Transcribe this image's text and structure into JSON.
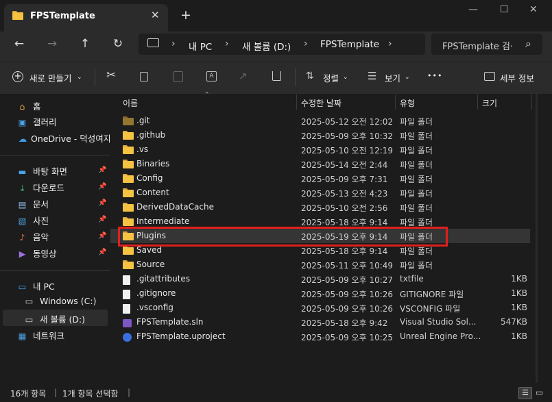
{
  "window": {
    "tab_title": "FPSTemplate",
    "tab_close": "✕",
    "tab_add": "+",
    "minimize": "—",
    "maximize": "☐",
    "close": "✕"
  },
  "nav": {
    "back": "←",
    "forward": "→",
    "up": "↑",
    "refresh": "↻",
    "breadcrumbs": [
      "내 PC",
      "새 볼륨 (D:)",
      "FPSTemplate"
    ],
    "search_placeholder": "FPSTemplate 검·",
    "search_icon": "⌕"
  },
  "toolbar": {
    "new_label": "새로 만들기",
    "sort_label": "정렬",
    "view_label": "보기",
    "more": "•••",
    "details_label": "세부 정보"
  },
  "sidebar": {
    "top_items": [
      {
        "label": "홈",
        "icon": "home-icon"
      },
      {
        "label": "갤러리",
        "icon": "gallery-icon"
      },
      {
        "label": "OneDrive - 덕성여자",
        "icon": "cloud-icon"
      }
    ],
    "quick_items": [
      {
        "label": "바탕 화면",
        "icon": "desktop-icon"
      },
      {
        "label": "다운로드",
        "icon": "download-icon"
      },
      {
        "label": "문서",
        "icon": "document-icon"
      },
      {
        "label": "사진",
        "icon": "pictures-icon"
      },
      {
        "label": "음악",
        "icon": "music-icon"
      },
      {
        "label": "동영상",
        "icon": "video-icon"
      }
    ],
    "pc_items": [
      {
        "label": "내 PC",
        "icon": "pc-icon"
      },
      {
        "label": "Windows (C:)",
        "icon": "drive-icon"
      },
      {
        "label": "새 볼륨 (D:)",
        "icon": "drive-icon"
      },
      {
        "label": "네트워크",
        "icon": "network-icon"
      }
    ]
  },
  "columns": {
    "name": "이름",
    "date": "수정한 날짜",
    "type": "유형",
    "size": "크기"
  },
  "files": [
    {
      "name": ".git",
      "date": "2025-05-12 오전 12:02",
      "type": "파일 폴더",
      "size": "",
      "icon": "folder-icon"
    },
    {
      "name": ".github",
      "date": "2025-05-09 오후 10:32",
      "type": "파일 폴더",
      "size": "",
      "icon": "folder-icon"
    },
    {
      "name": ".vs",
      "date": "2025-05-10 오전 12:19",
      "type": "파일 폴더",
      "size": "",
      "icon": "folder-icon"
    },
    {
      "name": "Binaries",
      "date": "2025-05-14 오전 2:44",
      "type": "파일 폴더",
      "size": "",
      "icon": "folder-icon"
    },
    {
      "name": "Config",
      "date": "2025-05-09 오후 7:31",
      "type": "파일 폴더",
      "size": "",
      "icon": "folder-icon"
    },
    {
      "name": "Content",
      "date": "2025-05-13 오전 4:23",
      "type": "파일 폴더",
      "size": "",
      "icon": "folder-icon"
    },
    {
      "name": "DerivedDataCache",
      "date": "2025-05-10 오전 2:56",
      "type": "파일 폴더",
      "size": "",
      "icon": "folder-icon"
    },
    {
      "name": "Intermediate",
      "date": "2025-05-18 오후 9:14",
      "type": "파일 폴더",
      "size": "",
      "icon": "folder-icon"
    },
    {
      "name": "Plugins",
      "date": "2025-05-19 오후 9:14",
      "type": "파일 폴더",
      "size": "",
      "icon": "folder-icon"
    },
    {
      "name": "Saved",
      "date": "2025-05-18 오후 9:14",
      "type": "파일 폴더",
      "size": "",
      "icon": "folder-icon"
    },
    {
      "name": "Source",
      "date": "2025-05-11 오후 10:49",
      "type": "파일 폴더",
      "size": "",
      "icon": "folder-icon"
    },
    {
      "name": ".gitattributes",
      "date": "2025-05-09 오후 10:27",
      "type": "txtfile",
      "size": "1KB",
      "icon": "file-icon"
    },
    {
      "name": ".gitignore",
      "date": "2025-05-09 오후 10:26",
      "type": "GITIGNORE 파일",
      "size": "1KB",
      "icon": "file-icon"
    },
    {
      "name": ".vsconfig",
      "date": "2025-05-09 오후 10:26",
      "type": "VSCONFIG 파일",
      "size": "1KB",
      "icon": "file-icon"
    },
    {
      "name": "FPSTemplate.sln",
      "date": "2025-05-18 오후 9:42",
      "type": "Visual Studio Sol...",
      "size": "547KB",
      "icon": "sln-icon"
    },
    {
      "name": "FPSTemplate.uproject",
      "date": "2025-05-09 오후 10:25",
      "type": "Unreal Engine Pro...",
      "size": "1KB",
      "icon": "unreal-icon"
    }
  ],
  "status": {
    "count": "16개 항목",
    "selected": "1개 항목 선택함"
  }
}
